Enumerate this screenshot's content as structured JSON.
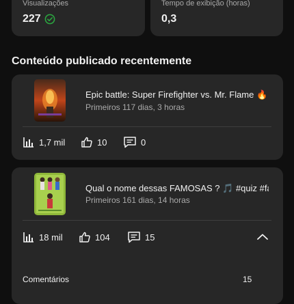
{
  "stats": [
    {
      "label": "Visualizações",
      "value": "227",
      "icon": "check-circle-icon"
    },
    {
      "label": "Tempo de exibição (horas)",
      "value": "0,3"
    }
  ],
  "section_title": "Conteúdo publicado recentemente",
  "videos": [
    {
      "title": "Epic battle: Super Firefighter vs. Mr. Flame 🔥",
      "subtitle": "Primeiros 117 dias, 3 horas",
      "views": "1,7 mil",
      "likes": "10",
      "comments": "0"
    },
    {
      "title": "Qual o nome dessas FAMOSAS ? 🎵 #quiz #fa...",
      "subtitle": "Primeiros 161 dias, 14 horas",
      "views": "18 mil",
      "likes": "104",
      "comments": "15"
    }
  ],
  "expanded": {
    "comments_label": "Comentários",
    "comments_count": "15"
  },
  "colors": {
    "background": "#0f0f0f",
    "card": "#272727",
    "secondary_text": "#aaaaaa",
    "check": "#2ba640"
  }
}
